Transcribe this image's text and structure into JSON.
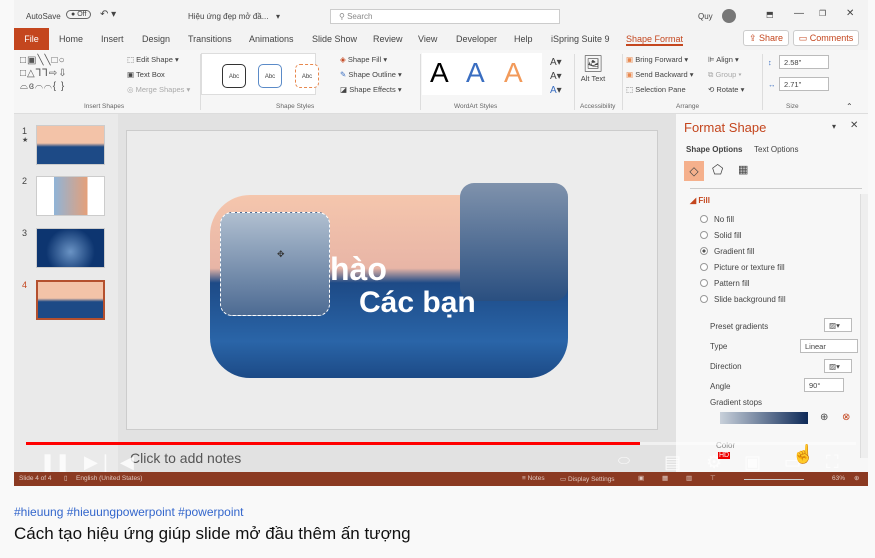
{
  "titlebar": {
    "autosave": "AutoSave",
    "toggle": "Off",
    "doc_title": "Hiệu ứng đẹp mở đầ...",
    "search_placeholder": "Search",
    "user": "Quy"
  },
  "tabs": [
    "File",
    "Home",
    "Insert",
    "Design",
    "Transitions",
    "Animations",
    "Slide Show",
    "Review",
    "View",
    "Developer",
    "Help",
    "iSpring Suite 9",
    "Shape Format"
  ],
  "share": "Share",
  "comments": "Comments",
  "ribbon": {
    "edit_shape": "Edit Shape",
    "text_box": "Text Box",
    "merge_shapes": "Merge Shapes",
    "insert_shapes": "Insert Shapes",
    "abc": "Abc",
    "shape_fill": "Shape Fill",
    "shape_outline": "Shape Outline",
    "shape_effects": "Shape Effects",
    "shape_styles": "Shape Styles",
    "wordart_a": "A",
    "wordart_styles": "WordArt Styles",
    "alt_text": "Alt Text",
    "accessibility": "Accessibility",
    "bring_forward": "Bring Forward",
    "send_backward": "Send Backward",
    "selection_pane": "Selection Pane",
    "align": "Align",
    "group": "Group",
    "rotate": "Rotate",
    "arrange": "Arrange",
    "height": "2.58\"",
    "width": "2.71\"",
    "size": "Size"
  },
  "slides": [
    {
      "num": "1",
      "star": "★"
    },
    {
      "num": "2"
    },
    {
      "num": "3"
    },
    {
      "num": "4"
    }
  ],
  "slide": {
    "line1": "hào",
    "line2": "Các bạn"
  },
  "pane": {
    "title": "Format Shape",
    "tab1": "Shape Options",
    "tab2": "Text Options",
    "section": "Fill",
    "options": [
      "No fill",
      "Solid fill",
      "Gradient fill",
      "Picture or texture fill",
      "Pattern fill",
      "Slide background fill"
    ],
    "selected": 2,
    "preset": "Preset gradients",
    "type_label": "Type",
    "type_value": "Linear",
    "direction": "Direction",
    "angle_label": "Angle",
    "angle_value": "90°",
    "stops": "Gradient stops",
    "color": "Color"
  },
  "status": {
    "slide": "Slide 4 of 4",
    "lang": "English (United States)",
    "notes": "Notes",
    "display": "Display Settings",
    "zoom": "63%"
  },
  "notes_placeholder": "Click to add notes",
  "player": {
    "progress": 0.74,
    "hd": "HD"
  },
  "video": {
    "tags": "#hieuung #hieuungpowerpoint #powerpoint",
    "title": "Cách tạo hiệu ứng giúp slide mở đầu thêm ấn tượng"
  },
  "colors": {
    "accent": "#c4461e",
    "status": "#8b3a22",
    "progress": "#ff0000"
  }
}
